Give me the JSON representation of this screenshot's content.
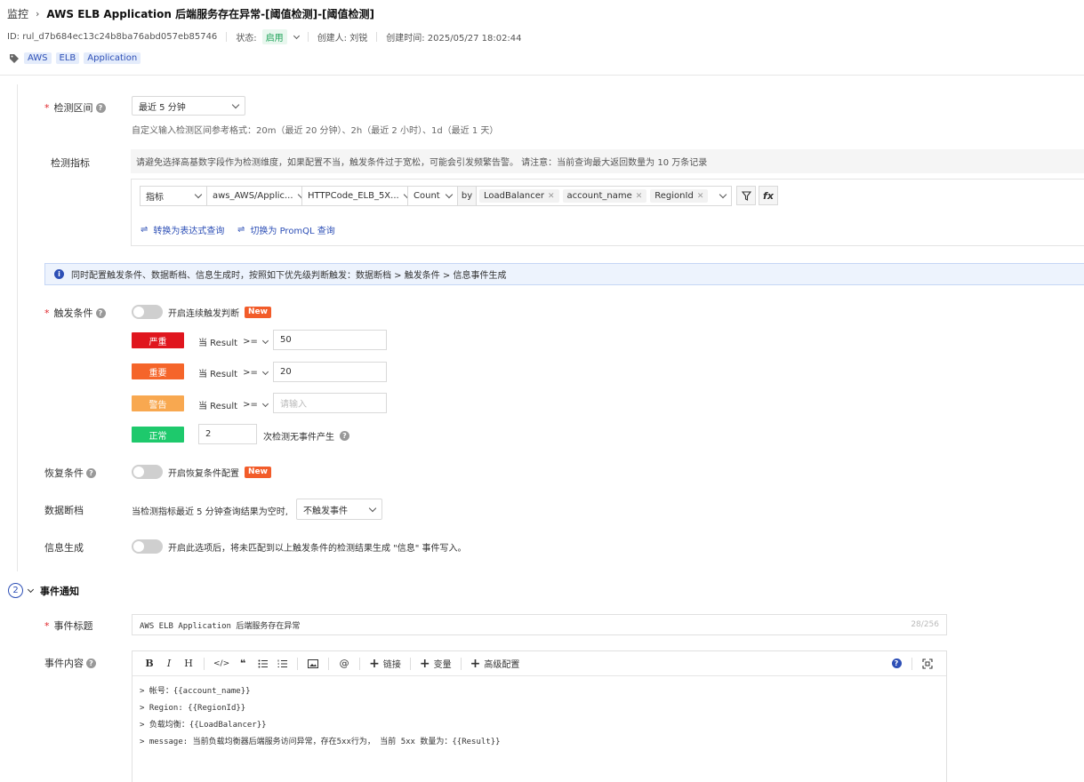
{
  "header": {
    "breadcrumb_root": "监控",
    "title": "AWS ELB Application 后端服务存在异常-[阈值检测]-[阈值检测]",
    "id_text": "ID: rul_d7b684ec13c24b8ba76abd057eb85746",
    "status_label": "状态:",
    "status_value": "启用",
    "creator": "创建人: 刘锐",
    "created_time": "创建时间: 2025/05/27 18:02:44",
    "tags": [
      "AWS",
      "ELB",
      "Application"
    ]
  },
  "detect_range": {
    "label": "检测区间",
    "value": "最近 5 分钟",
    "hint": "自定义输入检测区间参考格式：20m（最近 20 分钟）、2h（最近 2 小时）、1d（最近 1 天）"
  },
  "detect_metric": {
    "label": "检测指标",
    "warning": "请避免选择高基数字段作为检测维度，如果配置不当，触发条件过于宽松，可能会引发频繁告警。 请注意：当前查询最大返回数量为 10 万条记录",
    "type": "指标",
    "namespace": "aws_AWS/Applic...",
    "metric": "HTTPCode_ELB_5X...",
    "aggregation": "Count",
    "by_label": "by",
    "group_by": [
      "LoadBalancer",
      "account_name",
      "RegionId"
    ],
    "fx_label": "fx",
    "link_expression": "转换为表达式查询",
    "link_promql": "切换为 PromQL 查询"
  },
  "info_banner": "同时配置触发条件、数据断档、信息生成时，按照如下优先级判断触发：数据断档 > 触发条件 > 信息事件生成",
  "trigger": {
    "label": "触发条件",
    "switch_label": "开启连续触发判断",
    "new_badge": "New",
    "levels": [
      {
        "name": "严重",
        "color": "#e0161e",
        "cond": "当 Result",
        "op": ">=",
        "value": "50"
      },
      {
        "name": "重要",
        "color": "#f5652a",
        "cond": "当 Result",
        "op": ">=",
        "value": "20"
      },
      {
        "name": "警告",
        "color": "#f8a850",
        "cond": "当 Result",
        "op": ">=",
        "placeholder": "请输入"
      }
    ],
    "normal": {
      "name": "正常",
      "color": "#1ec96c",
      "value": "2",
      "suffix": "次检测无事件产生"
    }
  },
  "recovery": {
    "label": "恢复条件",
    "switch_label": "开启恢复条件配置",
    "new_badge": "New"
  },
  "data_gap": {
    "label": "数据断档",
    "text": "当检测指标最近 5 分钟查询结果为空时,",
    "value": "不触发事件"
  },
  "info_gen": {
    "label": "信息生成",
    "text": "开启此选项后，将未匹配到以上触发条件的检测结果生成 \"信息\" 事件写入。"
  },
  "notify": {
    "step": "2",
    "title": "事件通知",
    "event_title_label": "事件标题",
    "event_title_value": "AWS ELB Application 后端服务存在异常",
    "event_title_count": "28/256",
    "content_label": "事件内容",
    "toolbar": {
      "bold": "B",
      "italic": "I",
      "heading": "H",
      "code": "</>",
      "quote": "❝",
      "at": "@",
      "link": "链接",
      "var": "变量",
      "advanced": "高级配置",
      "help": "?"
    },
    "content_lines": [
      "> 帐号：{{account_name}}",
      "> Region: {{RegionId}}",
      "> 负载均衡：{{LoadBalancer}}",
      "> message: 当前负载均衡器后端服务访问异常，存在5xx行为， 当前 5xx 数量为：{{Result}}"
    ]
  }
}
